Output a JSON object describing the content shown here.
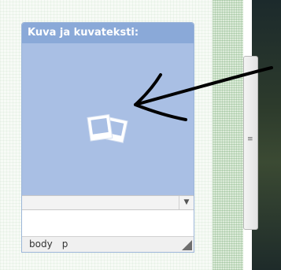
{
  "panel": {
    "title": "Kuva ja kuvateksti:",
    "image_placeholder_icon": "photo-stack-icon",
    "caption_value": ""
  },
  "status_bar": {
    "path": [
      "body",
      "p"
    ]
  },
  "colors": {
    "panel_header": "#8aa9d8",
    "image_area": "#a9bfe4",
    "annotation_arrow": "#000000"
  },
  "annotation": {
    "type": "hand-drawn arrow",
    "points_to": "photo-stack-icon"
  }
}
